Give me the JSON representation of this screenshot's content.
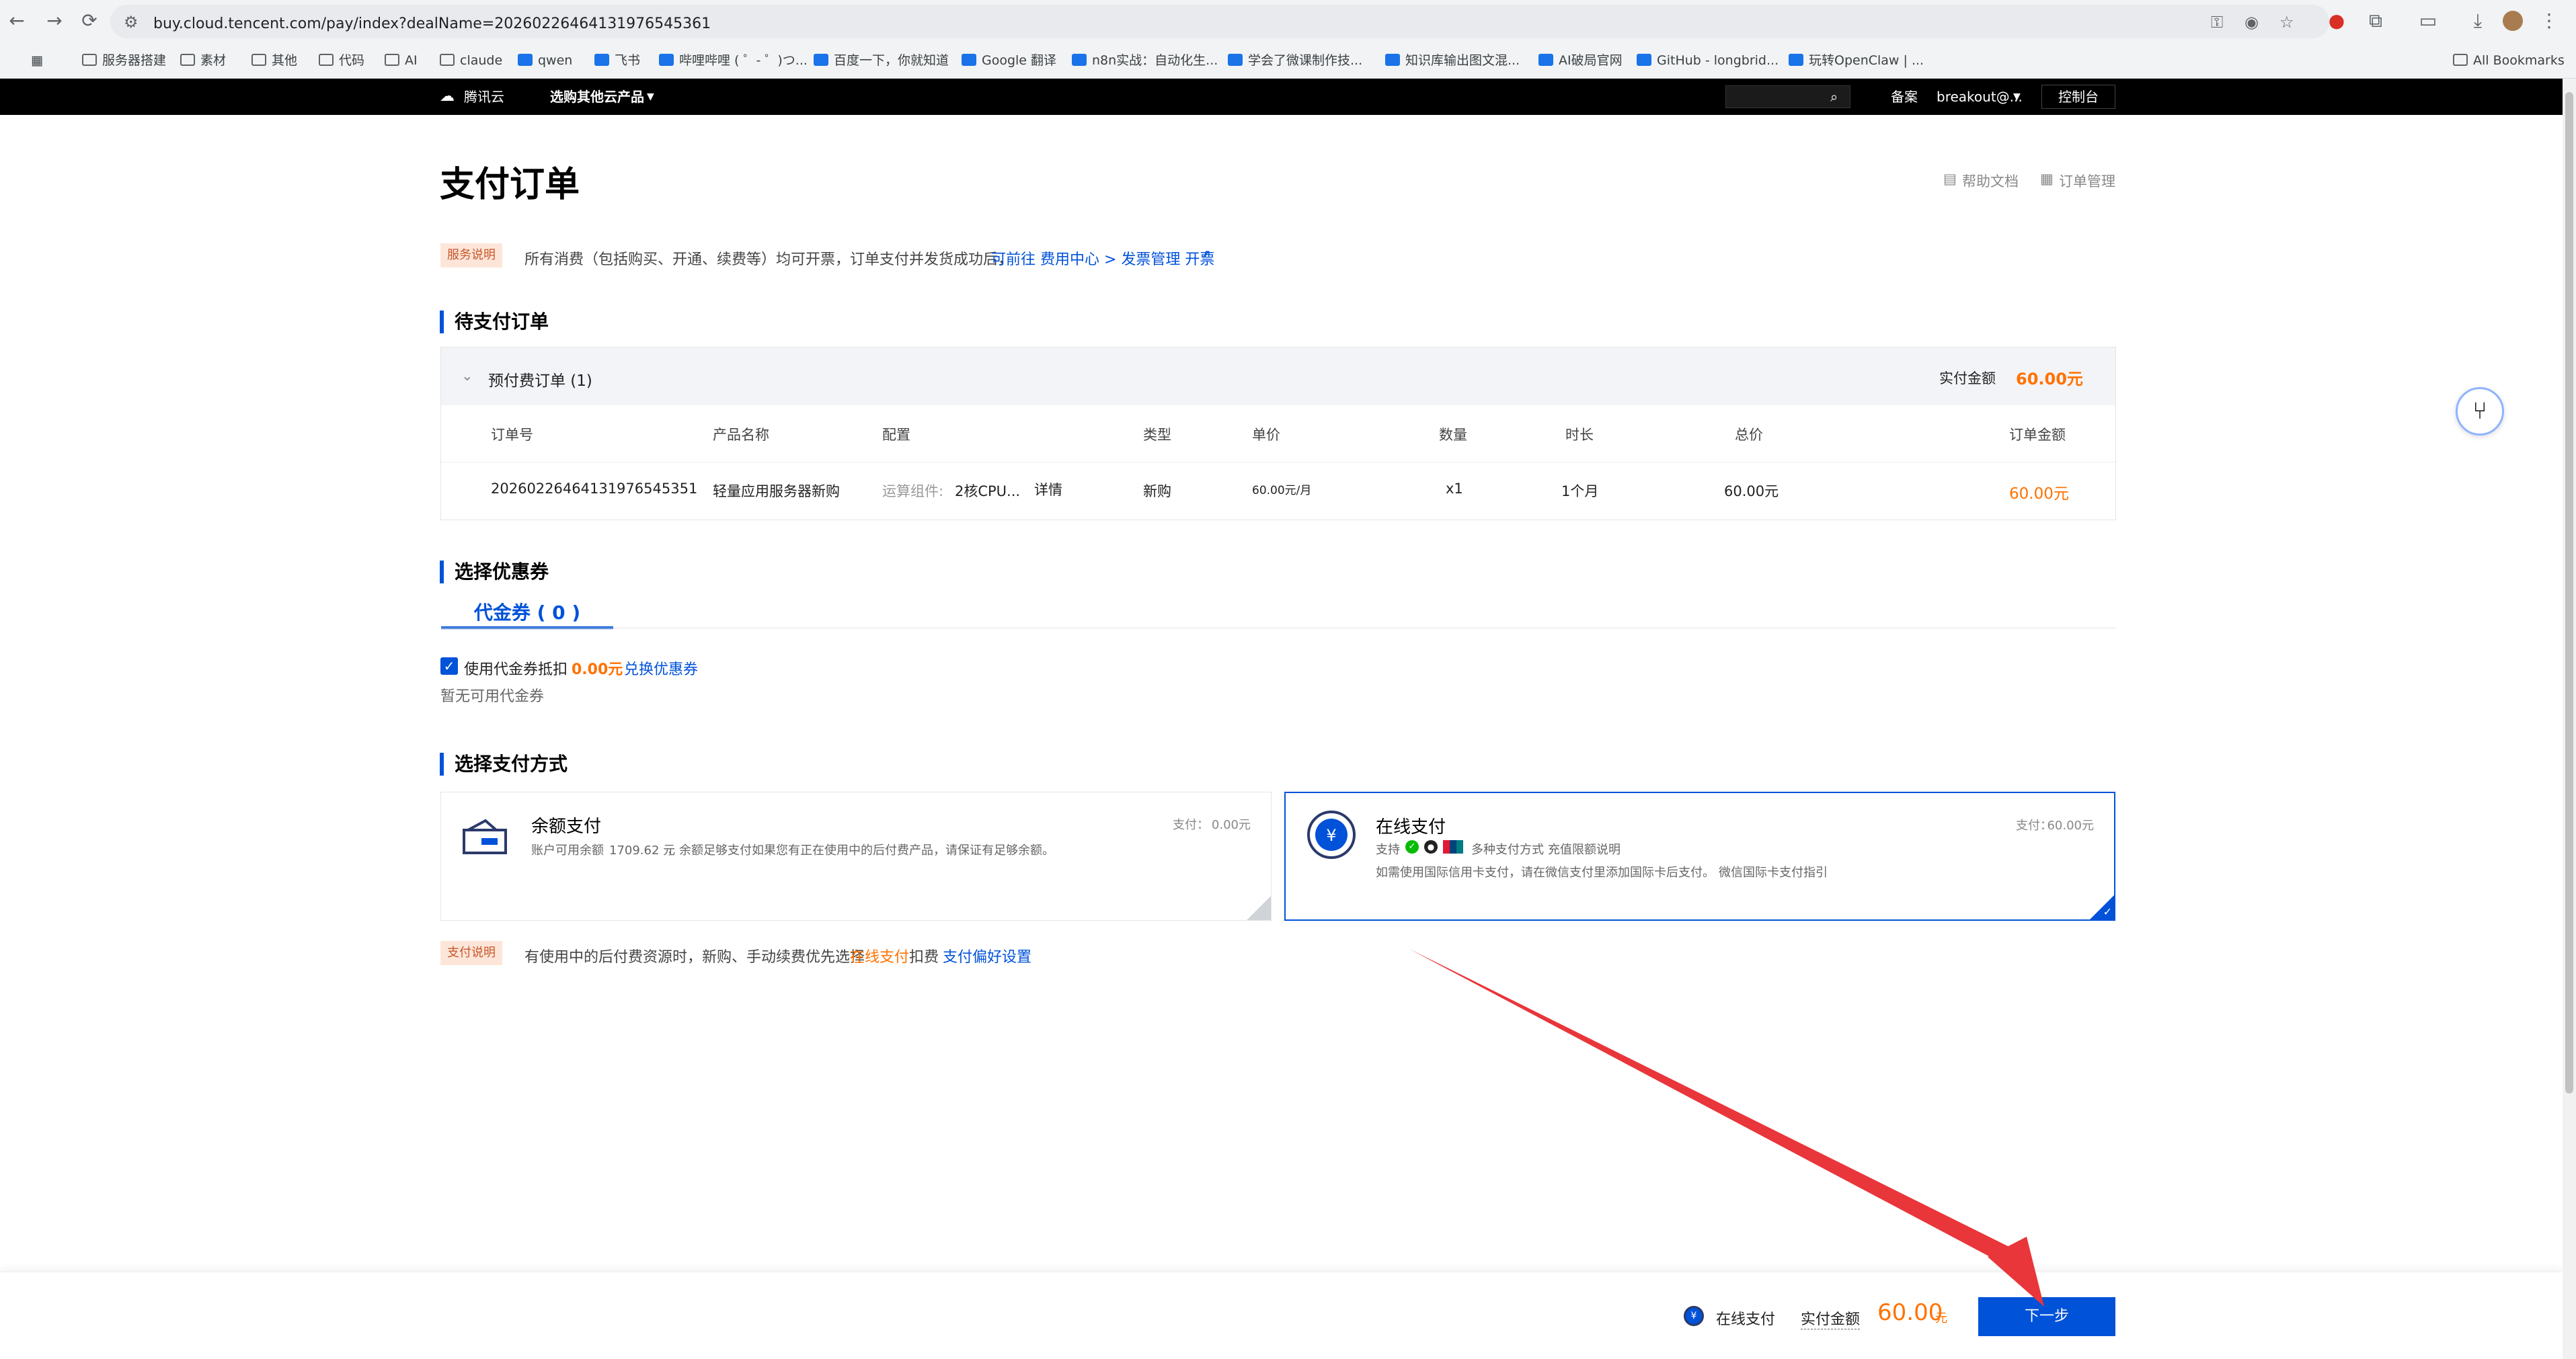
{
  "browser": {
    "url": "buy.cloud.tencent.com/pay/index?dealName=20260226464131976545361",
    "bookmarks": [
      "服务器搭建",
      "素材",
      "其他",
      "代码",
      "AI",
      "claude",
      "qwen",
      "飞书",
      "哔哩哔哩 ( ゜- ゜)つ...",
      "百度一下，你就知道",
      "Google 翻译",
      "n8n实战：自动化生...",
      "学会了微课制作技...",
      "知识库输出图文混...",
      "AI破局官网",
      "GitHub - longbrid...",
      "玩转OpenClaw | ..."
    ],
    "all_bookmarks": "All Bookmarks"
  },
  "header": {
    "logo": "腾讯云",
    "product_menu": "选购其他云产品",
    "record": "备案",
    "account": "breakout@...",
    "console": "控制台"
  },
  "page": {
    "title": "支付订单",
    "help_doc": "帮助文档",
    "order_mgmt": "订单管理",
    "service_badge": "服务说明",
    "service_text": "所有消费（包括购买、开通、续费等）均可开票，订单支付并发货成功后，",
    "service_link": "可前往 费用中心 > 发票管理 开票"
  },
  "pending": {
    "section_title": "待支付订单",
    "group_label": "预付费订单 (1)",
    "actual_label": "实付金额",
    "actual_amount": "60.00元",
    "columns": [
      "订单号",
      "产品名称",
      "配置",
      "类型",
      "单价",
      "数量",
      "时长",
      "总价",
      "订单金额"
    ],
    "row": {
      "order_no": "20260226464131976545351",
      "product": "轻量应用服务器新购",
      "config_label": "运算组件:",
      "config_value": "2核CPU...",
      "detail": "详情",
      "type": "新购",
      "unit_price": "60.00元/月",
      "qty": "x1",
      "duration": "1个月",
      "total": "60.00元",
      "amount": "60.00元"
    }
  },
  "coupon": {
    "section_title": "选择优惠券",
    "tab": "代金券 ( 0 )",
    "use_label": "使用代金券抵扣",
    "use_amount": "0.00元",
    "exchange": "兑换优惠券",
    "none": "暂无可用代金券"
  },
  "payment": {
    "section_title": "选择支付方式",
    "balance": {
      "title": "余额支付",
      "pay_label": "支付：",
      "pay_amount": "0.00元",
      "desc_a": "账户可用余额",
      "balance_value": "1709.62 元",
      "desc_b": "，余额足够支付如果您有正在使用中的后付费产品，请保证有足够余额。"
    },
    "online": {
      "title": "在线支付",
      "pay_label": "支付：",
      "pay_amount": "60.00元",
      "support": "支持",
      "methods": "多种支付方式",
      "limit_link": "充值限额说明",
      "note": "如需使用国际信用卡支付，请在微信支付里添加国际卡后支付。",
      "intl_link": "微信国际卡支付指引"
    },
    "note_badge": "支付说明",
    "note_a": "有使用中的后付费资源时，新购、手动续费优先选择",
    "note_highlight": "在线支付",
    "note_b": "扣费",
    "note_link": "支付偏好设置"
  },
  "bottom": {
    "method": "在线支付",
    "actual_label": "实付金额",
    "amount": "60.00",
    "unit": "元",
    "next": "下一步"
  },
  "colors": {
    "accent": "#0052d9",
    "price": "#ff7200",
    "annotation_arrow": "#e8363a"
  }
}
